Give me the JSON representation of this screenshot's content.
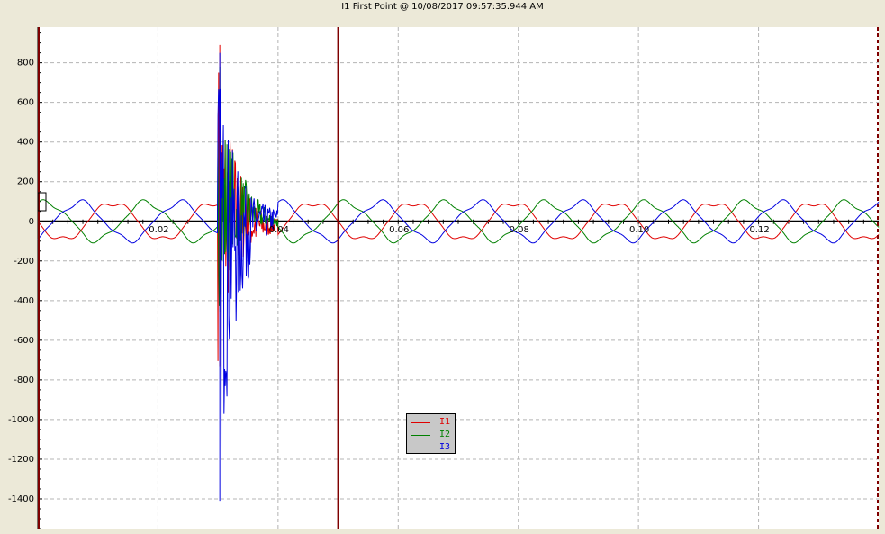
{
  "window": {
    "title": "I1 First Point @ 10/08/2017 09:57:35.944 AM"
  },
  "colors": {
    "background": "#FFFFFF",
    "frame": "#ECE9D8",
    "grid": "#B4B4B4",
    "axis": "#000000",
    "cursor": "#7F0000",
    "I1": "#E00000",
    "I2": "#008000",
    "I3": "#0000E0"
  },
  "chart_data": {
    "type": "line",
    "title": "I1 First Point @ 10/08/2017 09:57:35.944 AM",
    "xlabel": "",
    "ylabel": "",
    "xlim": [
      0.0,
      0.14
    ],
    "ylim": [
      -1550,
      980
    ],
    "x_ticks": [
      0.02,
      0.04,
      0.06,
      0.08,
      0.1,
      0.12
    ],
    "x_tick_labels": [
      "0.02",
      "0.04",
      "0.06",
      "0.08",
      "0.10",
      "0.12"
    ],
    "y_ticks": [
      800,
      600,
      400,
      200,
      0,
      -200,
      -400,
      -600,
      -800,
      -1000,
      -1200,
      -1400
    ],
    "y_tick_labels": [
      "800",
      "600",
      "400",
      "200",
      "0",
      "-200",
      "-400",
      "-600",
      "-800",
      "-1000",
      "-1200",
      "-1400"
    ],
    "grid": true,
    "legend_position": "bottom-center",
    "cursors_x": [
      0.0,
      0.05,
      0.14
    ],
    "series": [
      {
        "name": "I1",
        "color": "#E00000",
        "steady_amplitude": 95,
        "frequency_hz": 60,
        "phase_deg": 180,
        "transient": {
          "start": 0.03,
          "end": 0.04,
          "min": -730,
          "max": 890
        }
      },
      {
        "name": "I2",
        "color": "#008000",
        "steady_amplitude": 95,
        "frequency_hz": 60,
        "phase_deg": 60,
        "transient": {
          "start": 0.03,
          "end": 0.04,
          "min": -460,
          "max": 780
        }
      },
      {
        "name": "I3",
        "color": "#0000E0",
        "steady_amplitude": 95,
        "frequency_hz": 60,
        "phase_deg": -60,
        "transient": {
          "start": 0.03,
          "end": 0.04,
          "min": -1410,
          "max": 850
        }
      }
    ]
  },
  "legend": {
    "items": [
      {
        "label": "I1",
        "color": "#E00000"
      },
      {
        "label": "I2",
        "color": "#008000"
      },
      {
        "label": "I3",
        "color": "#0000E0"
      }
    ]
  }
}
